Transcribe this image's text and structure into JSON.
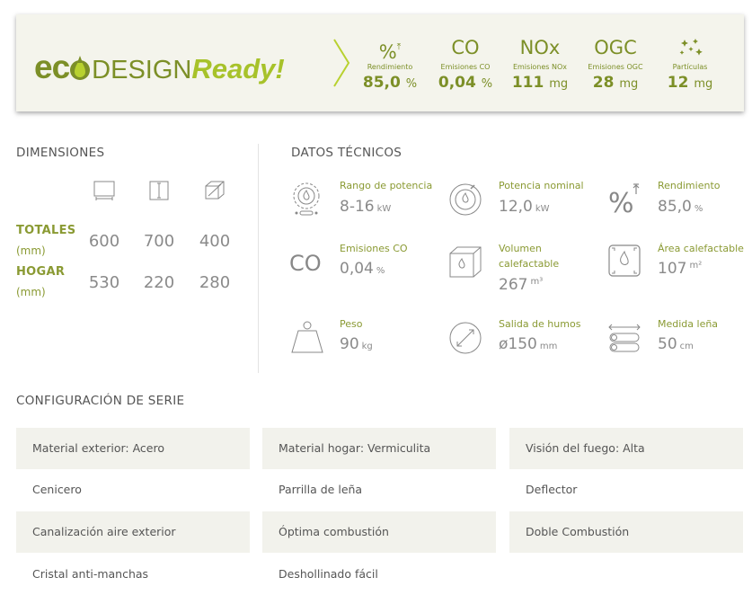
{
  "banner": {
    "logo": {
      "eco": "ec",
      "design": "DESIGN",
      "ready": "Ready!"
    },
    "metrics": [
      {
        "symbol": "%",
        "label": "Rendimiento",
        "value": "85,0",
        "unit": "%",
        "icon": "percent-up-icon"
      },
      {
        "symbol": "CO",
        "label": "Emisiones CO",
        "value": "0,04",
        "unit": "%",
        "icon": ""
      },
      {
        "symbol": "NOx",
        "label": "Emisiones NOx",
        "value": "111",
        "unit": "mg",
        "icon": ""
      },
      {
        "symbol": "OGC",
        "label": "Emisiones OGC",
        "value": "28",
        "unit": "mg",
        "icon": ""
      },
      {
        "symbol": "",
        "label": "Partículas",
        "value": "12",
        "unit": "mg",
        "icon": "particles-icon"
      }
    ]
  },
  "dimensiones": {
    "title": "DIMENSIONES",
    "icons": [
      "width-icon",
      "height-icon",
      "depth-icon"
    ],
    "rows": [
      {
        "label": "TOTALES",
        "unit": "(mm)",
        "values": [
          "600",
          "700",
          "400"
        ]
      },
      {
        "label": "HOGAR",
        "unit": "(mm)",
        "values": [
          "530",
          "220",
          "280"
        ]
      }
    ]
  },
  "datos": {
    "title": "DATOS TÉCNICOS",
    "items": [
      {
        "label": "Rango de potencia",
        "value": "8-16",
        "unit": "kW",
        "icon": "power-range-icon"
      },
      {
        "label": "Potencia nominal",
        "value": "12,0",
        "unit": "kW",
        "icon": "nominal-power-icon"
      },
      {
        "label": "Rendimiento",
        "value": "85,0",
        "unit": "%",
        "icon": "efficiency-icon"
      },
      {
        "label": "Emisiones CO",
        "value": "0,04",
        "unit": "%",
        "icon": "co-icon",
        "symbol": "CO"
      },
      {
        "label": "Volumen calefactable",
        "value": "267",
        "unit": "m³",
        "icon": "heated-volume-icon"
      },
      {
        "label": "Área calefactable",
        "value": "107",
        "unit": "m²",
        "icon": "heated-area-icon"
      },
      {
        "label": "Peso",
        "value": "90",
        "unit": "kg",
        "icon": "weight-icon"
      },
      {
        "label": "Salida de humos",
        "value": "ø150",
        "unit": "mm",
        "icon": "flue-outlet-icon"
      },
      {
        "label": "Medida leña",
        "value": "50",
        "unit": "cm",
        "icon": "firewood-icon"
      }
    ]
  },
  "configuracion": {
    "title": "CONFIGURACIÓN DE SERIE",
    "items": [
      "Material exterior: Acero",
      "Material hogar: Vermiculita",
      "Visión del fuego: Alta",
      "Cenicero",
      "Parrilla de leña",
      "Deflector",
      "Canalización aire exterior",
      "Óptima combustión",
      "Doble Combustión",
      "Cristal anti-manchas",
      "Deshollinado fácil"
    ]
  },
  "colors": {
    "brand_dark": "#7c8f27",
    "brand_light": "#a7c22a",
    "shade": "#f2f2ec"
  }
}
